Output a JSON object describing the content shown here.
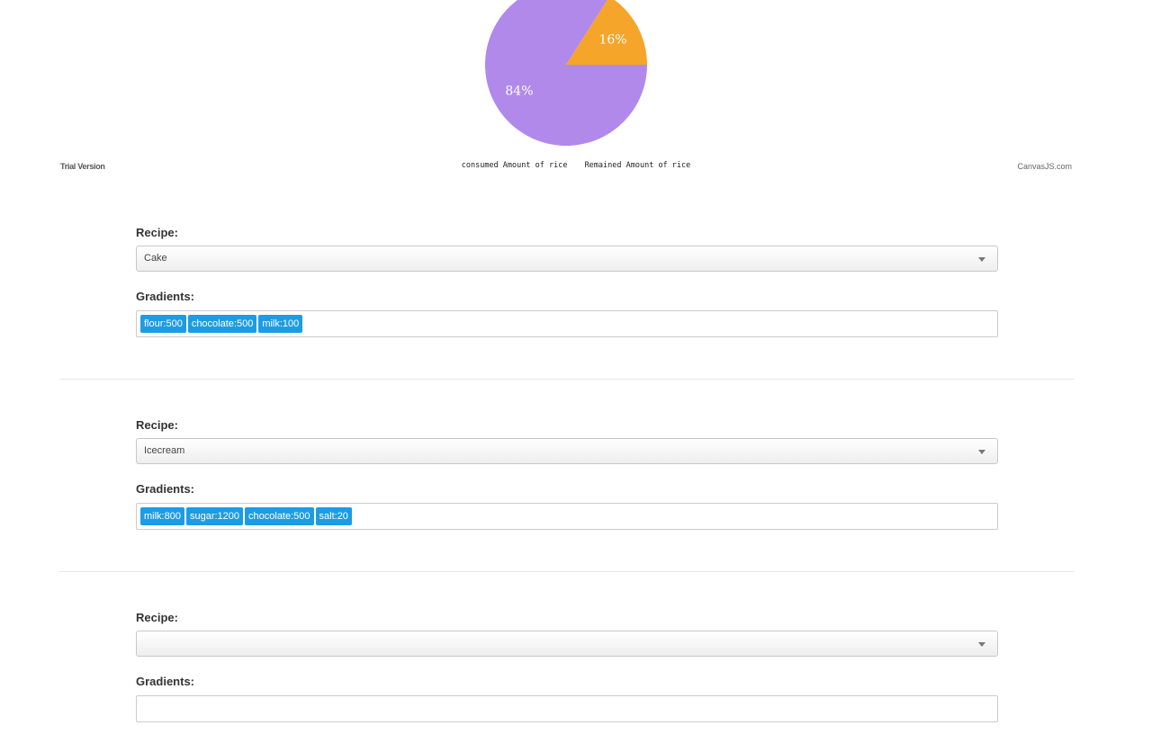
{
  "chart_data": {
    "type": "pie",
    "slices": [
      {
        "name": "consumed Amount of rice",
        "value": 16,
        "label": "16%",
        "color": "#f5a52a"
      },
      {
        "name": "Remained Amount of rice",
        "value": 84,
        "label": "84%",
        "color": "#b189eb"
      }
    ],
    "legend": [
      "consumed Amount of rice",
      "Remained Amount of rice"
    ],
    "legend_placement": "bottom",
    "watermark_left": "Trial Version",
    "watermark_right": "CanvasJS.com"
  },
  "recipes": [
    {
      "label": "Recipe:",
      "selected": "Cake",
      "gradients_label": "Gradients:",
      "tags": [
        "flour:500",
        "chocolate:500",
        "milk:100"
      ]
    },
    {
      "label": "Recipe:",
      "selected": "Icecream",
      "gradients_label": "Gradients:",
      "tags": [
        "milk:800",
        "sugar:1200",
        "chocolate:500",
        "salt:20"
      ]
    },
    {
      "label": "Recipe:",
      "selected": "",
      "gradients_label": "Gradients:",
      "tags": []
    }
  ]
}
